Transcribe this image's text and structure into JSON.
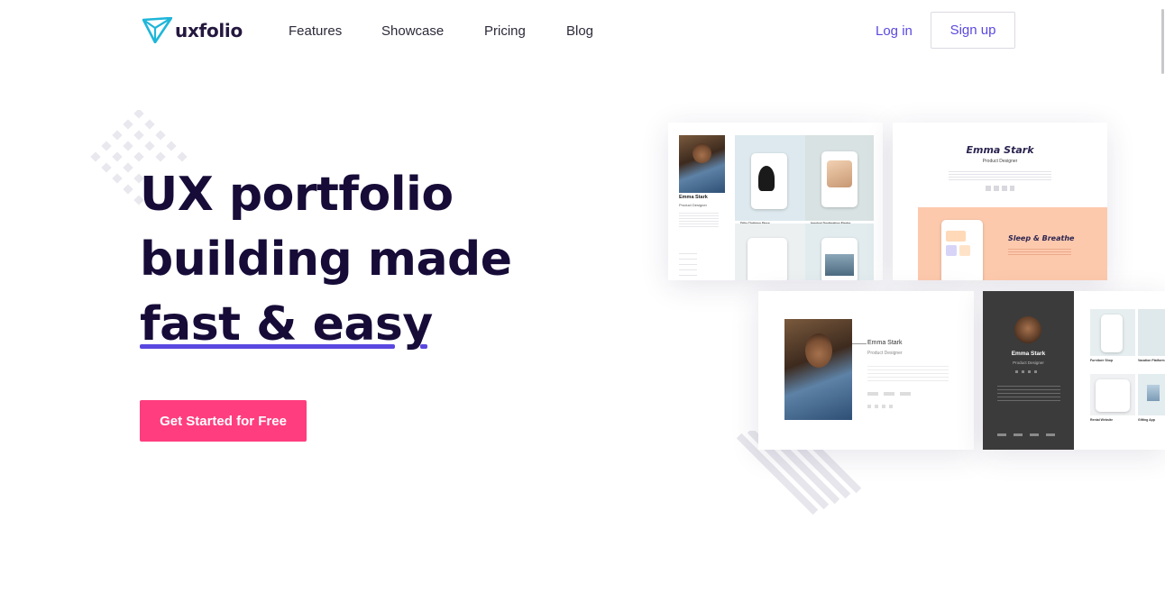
{
  "brand": {
    "name": "uxfolio",
    "logo_color": "#1fb6d9"
  },
  "nav": {
    "links": [
      "Features",
      "Showcase",
      "Pricing",
      "Blog"
    ],
    "login_label": "Log in",
    "signup_label": "Sign up",
    "accent": "#5a48e0"
  },
  "hero": {
    "line1": "UX portfolio",
    "line2": "building made",
    "line3": "fast & easy",
    "cta_label": "Get Started for Free",
    "cta_color": "#ff3d7f",
    "underline_color": "#5a48e0"
  },
  "mockups": {
    "card1": {
      "name": "Emma Stark",
      "role": "Product Designer",
      "tiles": [
        "Dillo Clothing Store",
        "Innsbot Destination Finder"
      ]
    },
    "card2": {
      "name": "Emma Stark",
      "role": "Product Designer",
      "project_title": "Sleep & Breathe"
    },
    "card3": {
      "name": "Emma Stark",
      "role": "Product Designer"
    },
    "card4": {
      "name": "Emma Stark",
      "role": "Product Designer",
      "tiles": [
        "Furniture Shop",
        "Vacation Platform",
        "Rental Website",
        "Gifting App"
      ]
    }
  }
}
